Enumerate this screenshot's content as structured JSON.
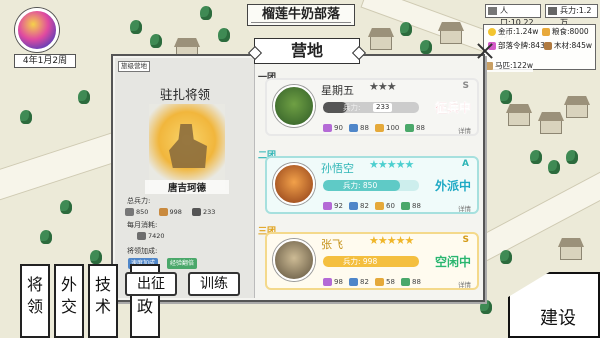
{
  "hud": {
    "date": "4年1月2周",
    "tribe_name": "榴莲牛奶部落",
    "population": "人口:10.22万",
    "troops": "兵力:1.2万",
    "gold": "金币:1.24w",
    "food": "粮食:8000",
    "tribe_orders": "部落令牌:843",
    "wood": "木材:845w",
    "horses": "马匹:122w"
  },
  "dialog": {
    "title": "营地",
    "camp_tag": "旅级营地",
    "garrison_title": "驻扎将领",
    "general_name": "唐吉珂德",
    "total_troops_label": "总兵力:",
    "stats": [
      "850",
      "998",
      "233"
    ],
    "monthly_cost_label": "每月消耗:",
    "monthly_cost": "7420",
    "bonus_label": "将领加成:",
    "bonuses": [
      "速度加成",
      "经验翻倍"
    ],
    "btn_expedition": "出征",
    "btn_train": "训练",
    "colors": {
      "c1": "#555555",
      "c2": "#5fcac6",
      "c3": "#f4bf3f",
      "status_red": "#e0243b",
      "status_blue": "#1ea9c4",
      "status_green": "#2bb66e"
    }
  },
  "teams": [
    {
      "label": "一团",
      "name": "星期五",
      "stars": "★★★",
      "grade": "S",
      "troop_label": "兵力:",
      "troop_value": "233",
      "troop_fill": 0.25,
      "status": "征兵中",
      "stats": [
        "90",
        "88",
        "100",
        "88"
      ],
      "detail": "详情"
    },
    {
      "label": "二团",
      "name": "孙悟空",
      "stars": "★★★★★",
      "grade": "A",
      "troop_label": "兵力: 850",
      "troop_fill": 0.8,
      "status": "外派中",
      "stats": [
        "92",
        "82",
        "60",
        "88"
      ],
      "detail": "详情"
    },
    {
      "label": "三团",
      "name": "张飞",
      "stars": "★★★★★",
      "grade": "S",
      "troop_label": "兵力: 998",
      "troop_fill": 1.0,
      "status": "空闲中",
      "stats": [
        "98",
        "82",
        "58",
        "88"
      ],
      "detail": "详情"
    }
  ],
  "menu": {
    "tiles": [
      "将领",
      "外交",
      "技术",
      "内政"
    ],
    "build": "建设"
  }
}
